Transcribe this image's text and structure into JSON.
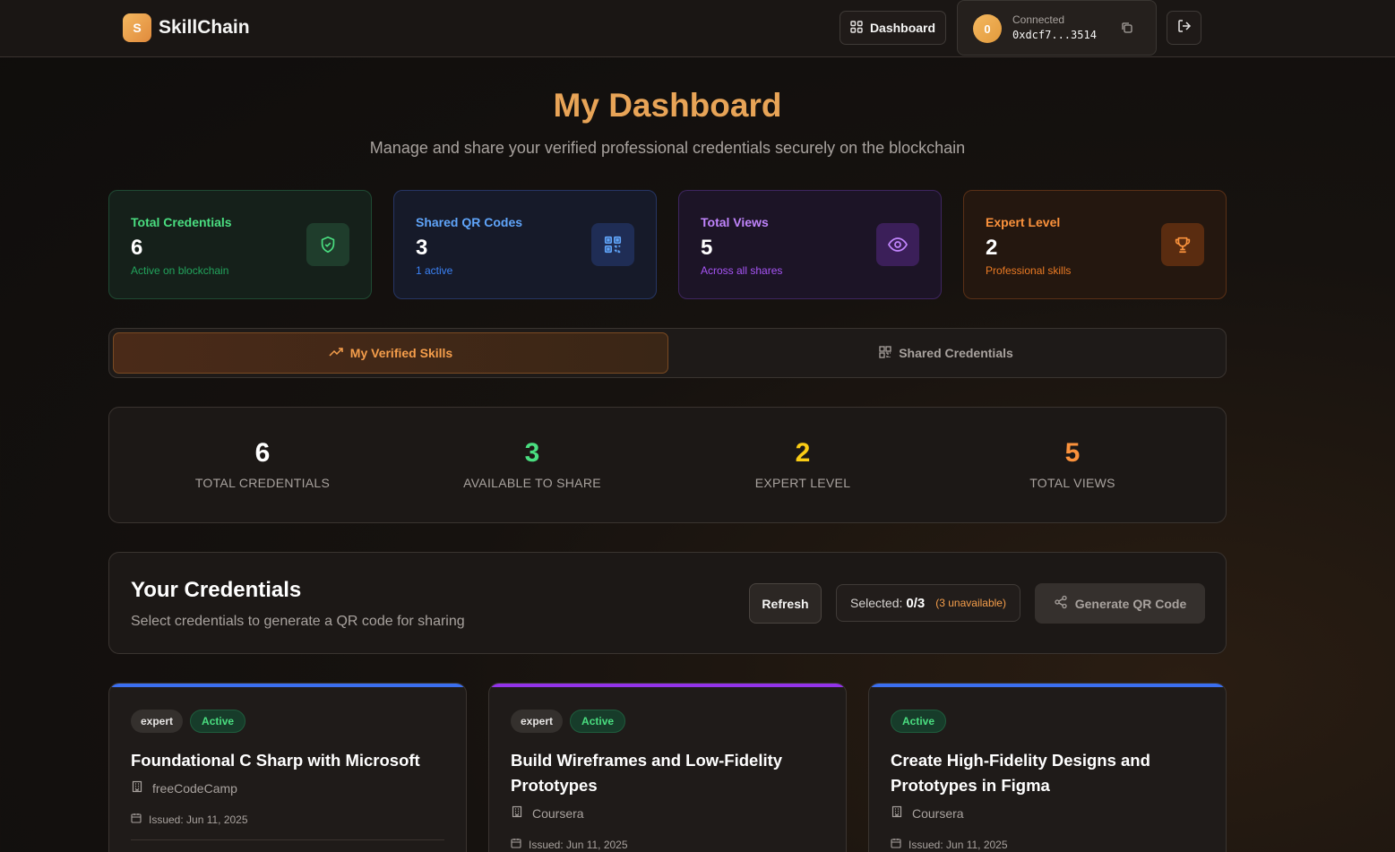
{
  "header": {
    "logo_letter": "S",
    "brand": "SkillChain",
    "nav_dashboard": "Dashboard",
    "wallet_avatar_letter": "0",
    "wallet_status": "Connected",
    "wallet_address": "0xdcf7...3514"
  },
  "page": {
    "title": "My Dashboard",
    "subtitle": "Manage and share your verified professional credentials securely on the blockchain"
  },
  "stats": [
    {
      "label": "Total Credentials",
      "value": "6",
      "sub": "Active on blockchain",
      "icon": "shield-check-icon"
    },
    {
      "label": "Shared QR Codes",
      "value": "3",
      "sub": "1 active",
      "icon": "qr-code-icon"
    },
    {
      "label": "Total Views",
      "value": "5",
      "sub": "Across all shares",
      "icon": "eye-icon"
    },
    {
      "label": "Expert Level",
      "value": "2",
      "sub": "Professional skills",
      "icon": "trophy-icon"
    }
  ],
  "tabs": {
    "active": "My Verified Skills",
    "inactive": "Shared Credentials"
  },
  "summary": [
    {
      "value": "6",
      "label": "TOTAL CREDENTIALS",
      "color": "#ffffff"
    },
    {
      "value": "3",
      "label": "AVAILABLE TO SHARE",
      "color": "#4ade80"
    },
    {
      "value": "2",
      "label": "EXPERT LEVEL",
      "color": "#facc15"
    },
    {
      "value": "5",
      "label": "TOTAL VIEWS",
      "color": "#fb923c"
    }
  ],
  "credentials_section": {
    "title": "Your Credentials",
    "subtitle": "Select credentials to generate a QR code for sharing",
    "refresh": "Refresh",
    "selected_label": "Selected:",
    "selected_count": "0/3",
    "unavailable": "(3 unavailable)",
    "generate": "Generate QR Code"
  },
  "cards": [
    {
      "level": "expert",
      "status": "Active",
      "title": "Foundational C Sharp with Microsoft",
      "issuer": "freeCodeCamp",
      "issued": "Issued: Jun 11, 2025",
      "accent": "#3b6ff0"
    },
    {
      "level": "expert",
      "status": "Active",
      "title": "Build Wireframes and Low-Fidelity Prototypes",
      "issuer": "Coursera",
      "issued": "Issued: Jun 11, 2025",
      "accent": "#9333ea"
    },
    {
      "status": "Active",
      "title": "Create High-Fidelity Designs and Prototypes in Figma",
      "issuer": "Coursera",
      "issued": "Issued: Jun 11, 2025",
      "accent": "#3b6ff0"
    }
  ]
}
